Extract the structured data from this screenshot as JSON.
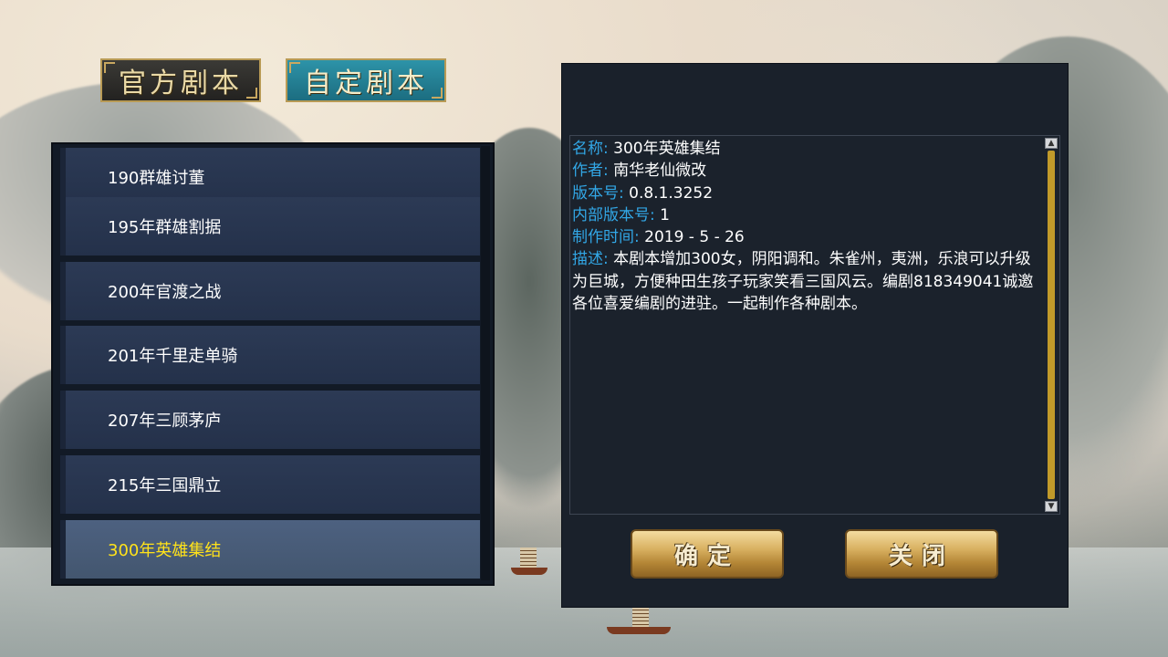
{
  "tabs": {
    "official": "官方剧本",
    "custom": "自定剧本"
  },
  "scenarios": [
    {
      "label": "190群雄讨董",
      "selected": false
    },
    {
      "label": "195年群雄割据",
      "selected": false
    },
    {
      "label": "200年官渡之战",
      "selected": false
    },
    {
      "label": "201年千里走单骑",
      "selected": false
    },
    {
      "label": "207年三顾茅庐",
      "selected": false
    },
    {
      "label": "215年三国鼎立",
      "selected": false
    },
    {
      "label": "300年英雄集结",
      "selected": true
    }
  ],
  "info": {
    "name_label": "名称:",
    "name": "300年英雄集结",
    "author_label": "作者:",
    "author": "南华老仙微改",
    "version_label": "版本号:",
    "version": "0.8.1.3252",
    "internal_label": "内部版本号:",
    "internal": "1",
    "date_label": "制作时间:",
    "date": "2019 - 5 - 26",
    "desc_label": "描述:",
    "desc": "本剧本增加300女，阴阳调和。朱雀州，夷洲，乐浪可以升级为巨城，方便种田生孩子玩家笑看三国风云。编剧818349041诚邀各位喜爱编剧的进驻。一起制作各种剧本。"
  },
  "buttons": {
    "confirm": "确定",
    "close": "关闭"
  },
  "colors": {
    "label_blue": "#32a7e6",
    "selected_yellow": "#ffe21a",
    "gold": "#c19a2a"
  }
}
